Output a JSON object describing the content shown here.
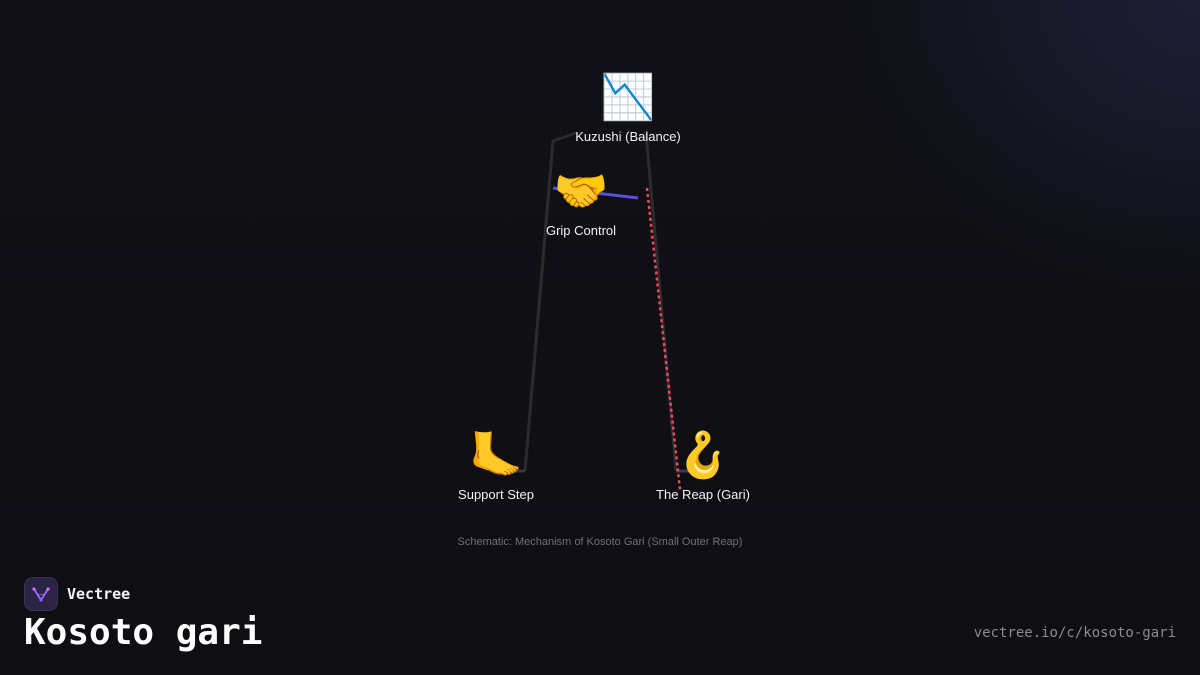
{
  "diagram": {
    "nodes": [
      {
        "id": "kuzushi",
        "icon": "chart-decreasing-icon",
        "emoji": "📉",
        "label": "Kuzushi (Balance)"
      },
      {
        "id": "grip",
        "icon": "handshake-icon",
        "emoji": "🤝",
        "label": "Grip Control"
      },
      {
        "id": "support",
        "icon": "foot-icon",
        "emoji": "🦶",
        "label": "Support Step"
      },
      {
        "id": "reap",
        "icon": "hook-icon",
        "emoji": "🪝",
        "label": "The Reap (Gari)"
      }
    ],
    "caption": "Schematic: Mechanism of Kosoto Gari (Small Outer Reap)",
    "colors": {
      "body_line": "#2b2b2f",
      "grip_line": "#5a4fe0",
      "reap_line": "#ee4b57"
    }
  },
  "brand": {
    "name": "Vectree"
  },
  "page": {
    "title": "Kosoto gari",
    "url": "vectree.io/c/kosoto-gari"
  }
}
